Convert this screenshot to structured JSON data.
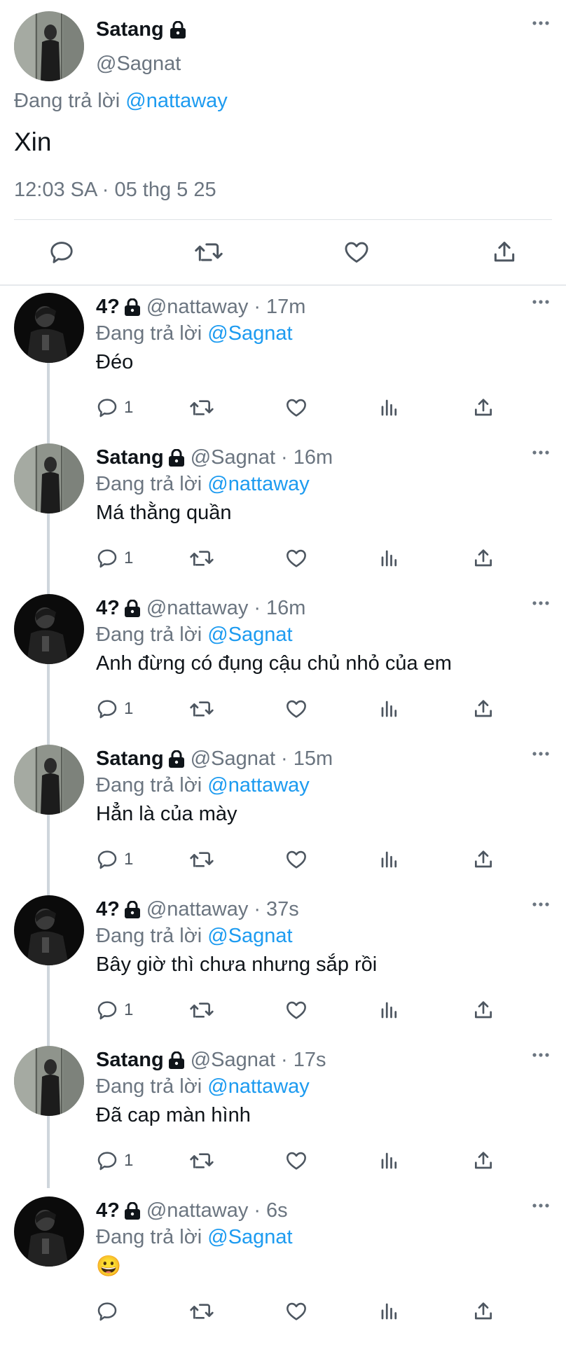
{
  "main_tweet": {
    "author_name": "Satang",
    "author_handle": "@Sagnat",
    "reply_prefix": "Đang trả lời",
    "reply_to": "@nattaway",
    "text": "Xin",
    "timestamp": "12:03 SA · 05 thg 5 25",
    "icons": [
      "reply-icon",
      "retweet-icon",
      "like-icon",
      "share-icon"
    ]
  },
  "replies": [
    {
      "name": "4?",
      "handle": "@nattaway",
      "time": "17m",
      "reply_prefix": "Đang trả lời",
      "reply_to": "@Sagnat",
      "text": "Đéo",
      "reply_count": "1",
      "avatar": "dark"
    },
    {
      "name": "Satang",
      "handle": "@Sagnat",
      "time": "16m",
      "reply_prefix": "Đang trả lời",
      "reply_to": "@nattaway",
      "text": "Má thằng quần",
      "reply_count": "1",
      "avatar": "light"
    },
    {
      "name": "4?",
      "handle": "@nattaway",
      "time": "16m",
      "reply_prefix": "Đang trả lời",
      "reply_to": "@Sagnat",
      "text": "Anh đừng có đụng cậu chủ nhỏ của em",
      "reply_count": "1",
      "avatar": "dark"
    },
    {
      "name": "Satang",
      "handle": "@Sagnat",
      "time": "15m",
      "reply_prefix": "Đang trả lời",
      "reply_to": "@nattaway",
      "text": "Hẳn là của mày",
      "reply_count": "1",
      "avatar": "light"
    },
    {
      "name": "4?",
      "handle": "@nattaway",
      "time": "37s",
      "reply_prefix": "Đang trả lời",
      "reply_to": "@Sagnat",
      "text": "Bây giờ thì chưa nhưng sắp rồi",
      "reply_count": "1",
      "avatar": "dark"
    },
    {
      "name": "Satang",
      "handle": "@Sagnat",
      "time": "17s",
      "reply_prefix": "Đang trả lời",
      "reply_to": "@nattaway",
      "text": "Đã cap màn hình",
      "reply_count": "1",
      "avatar": "light"
    },
    {
      "name": "4?",
      "handle": "@nattaway",
      "time": "6s",
      "reply_prefix": "Đang trả lời",
      "reply_to": "@Sagnat",
      "text": "😀",
      "reply_count": "",
      "avatar": "dark"
    }
  ],
  "separator": "·",
  "colors": {
    "link": "#1d9bf0",
    "secondary_text": "#6b7580",
    "primary_text": "#0f1419",
    "icon": "#4d5660"
  }
}
